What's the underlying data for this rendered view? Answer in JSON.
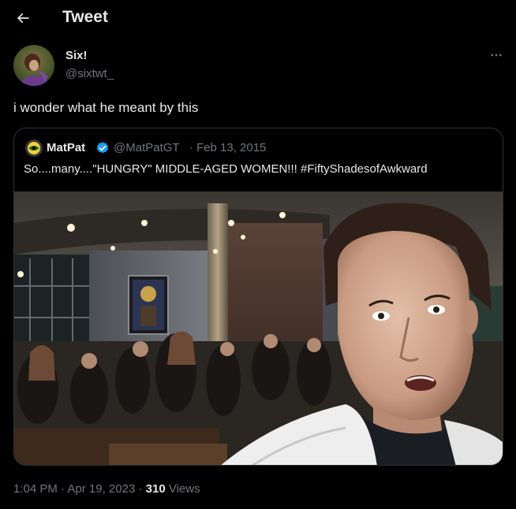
{
  "header": {
    "title": "Tweet"
  },
  "tweet": {
    "author_name": "Six!",
    "author_handle": "@sixtwt_",
    "text": "i wonder what he meant by this",
    "time": "1:04 PM",
    "date": "Apr 19, 2023",
    "separator": "·",
    "views_count": "310",
    "views_label": "Views"
  },
  "quote": {
    "author_name": "MatPat",
    "author_handle": "@MatPatGT",
    "separator": "·",
    "date": "Feb 13, 2015",
    "text": "So....many....\"HUNGRY\" MIDDLE-AGED WOMEN!!! #FiftyShadesofAwkward"
  },
  "colors": {
    "background": "#000000",
    "text_primary": "#e7e9ea",
    "text_secondary": "#71767b",
    "border": "#2f3336",
    "verified": "#1d9bf0"
  },
  "icons": {
    "back": "arrow-left-icon",
    "more": "more-horizontal-icon",
    "verified": "verified-badge-icon"
  }
}
